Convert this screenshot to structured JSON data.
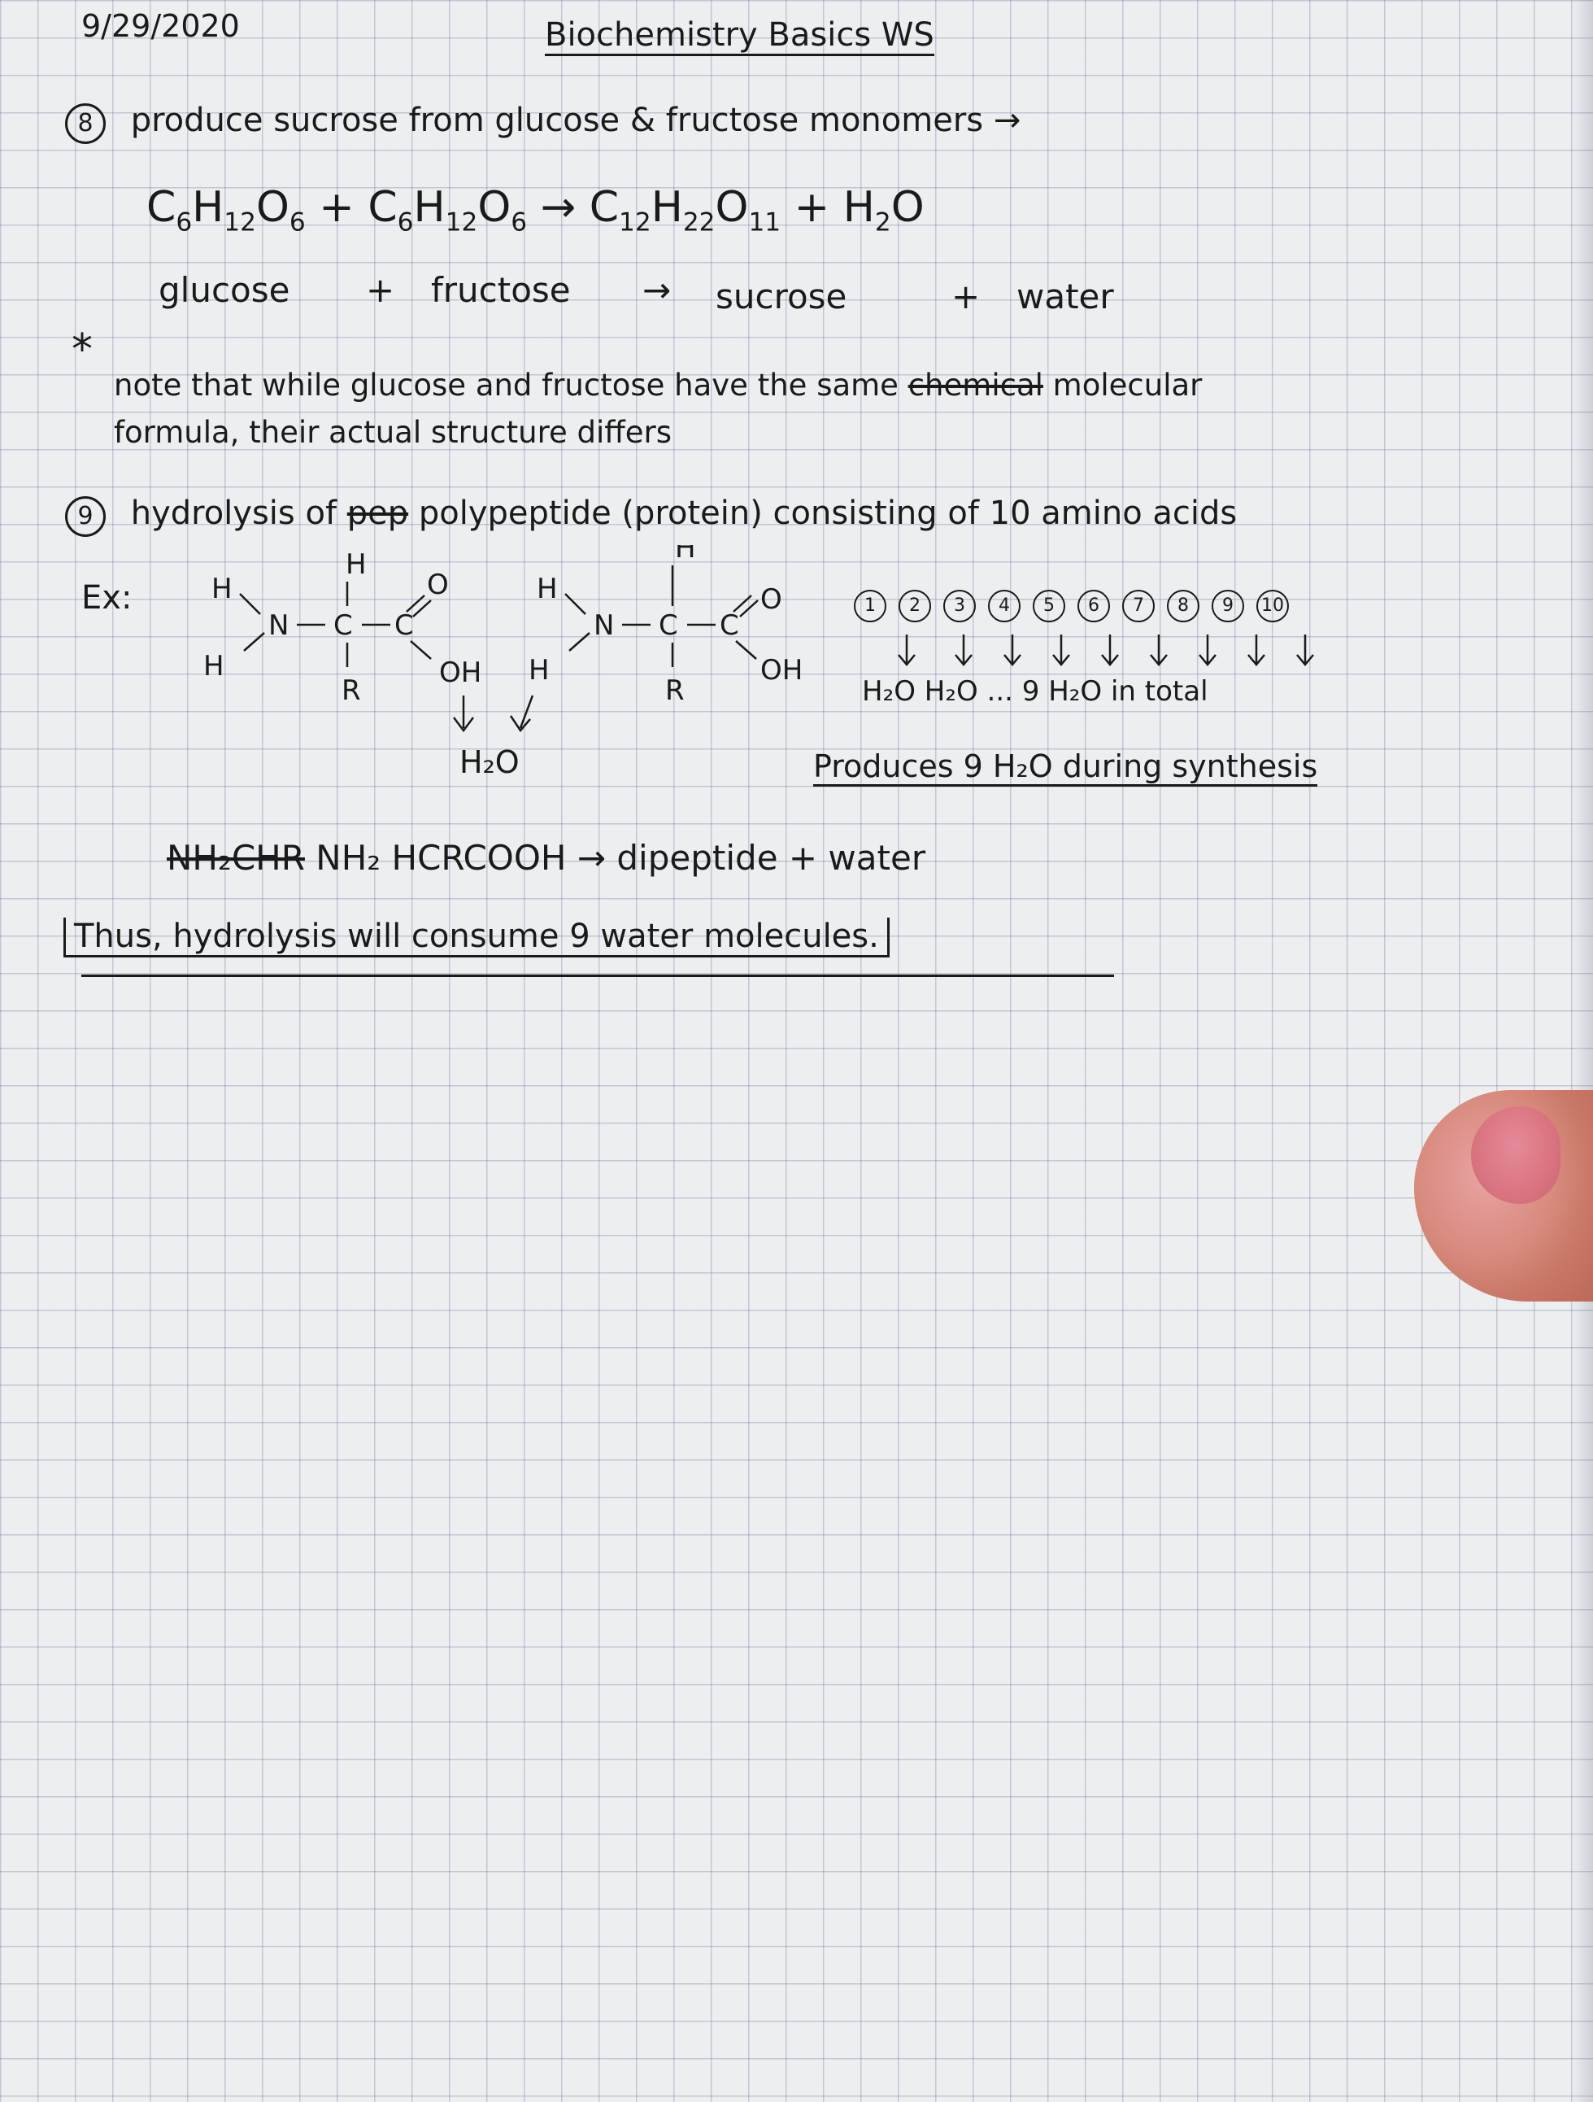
{
  "header": {
    "date": "9/29/2020",
    "title": "Biochemistry Basics WS"
  },
  "q8": {
    "number": "8",
    "prompt": "produce sucrose from glucose & fructose monomers →",
    "formula_names": {
      "glucose": "glucose",
      "plus": "+",
      "fructose": "fructose",
      "arrow": "→",
      "sucrose": "sucrose",
      "plus2": "+",
      "water": "water"
    },
    "note_star": "*",
    "note_line1": "note that while glucose and fructose have the same",
    "note_strike": "chemical",
    "note_line1_end": "molecular",
    "note_line2": "formula, their actual structure differs"
  },
  "q9": {
    "number": "9",
    "prompt": "hydrolysis of",
    "prompt_strike": "pep",
    "prompt_rest": "polypeptide (protein) consisting of 10 amino acids",
    "ex_label": "Ex:",
    "h2o_left": "H₂O",
    "chain_numbers": [
      "1",
      "2",
      "3",
      "4",
      "5",
      "6",
      "7",
      "8",
      "9",
      "10"
    ],
    "h2o_row": "H₂O  H₂O  ...  9  H₂O  in total",
    "produces": "Produces 9 H₂O during synthesis",
    "equation_strike": "NH₂CHR",
    "equation": "NH₂ HCRCOOH → dipeptide + water",
    "conclusion": "Thus, hydrolysis will consume 9 water molecules."
  }
}
